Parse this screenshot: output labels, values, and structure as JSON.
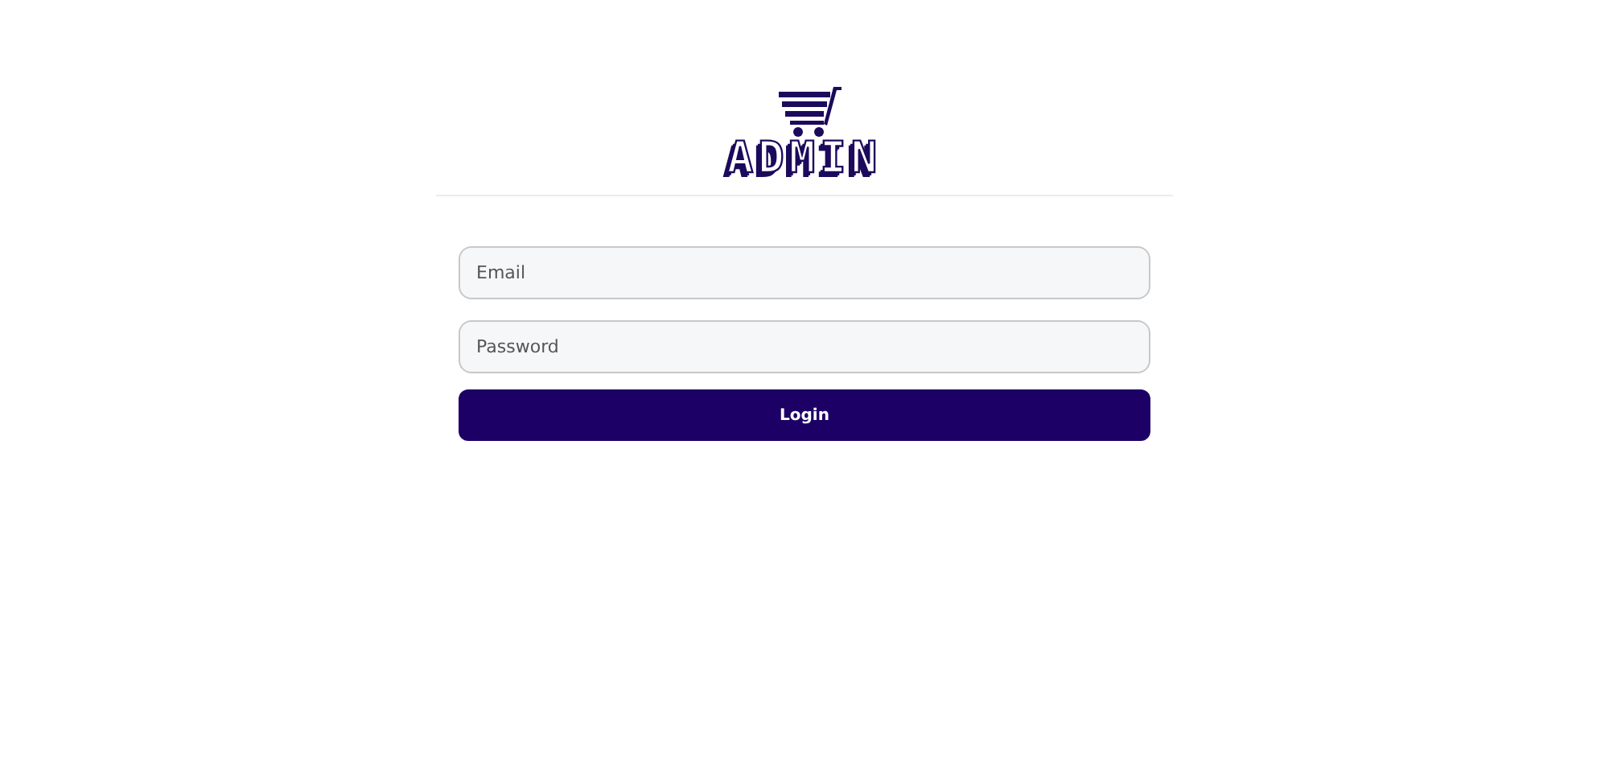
{
  "logo": {
    "text": "ADMIN"
  },
  "form": {
    "fields": [
      {
        "placeholder": "Email"
      },
      {
        "placeholder": "Password"
      }
    ],
    "button": "Login"
  }
}
